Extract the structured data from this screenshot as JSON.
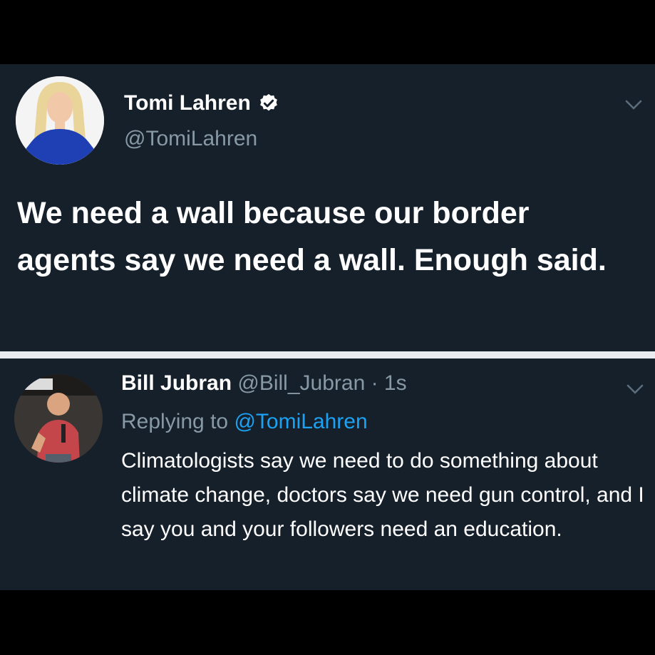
{
  "tweet": {
    "display_name": "Tomi Lahren",
    "handle": "@TomiLahren",
    "verified_icon": "verified-badge-icon",
    "text": "We need a wall because our border agents say we need a wall. Enough said.",
    "menu_icon": "chevron-down-icon"
  },
  "reply": {
    "display_name": "Bill Jubran",
    "handle": "@Bill_Jubran",
    "separator": " · ",
    "time": "1s",
    "replying_to_label": "Replying to",
    "replying_to_handle": "@TomiLahren",
    "text": "Climatologists say we need to do something about climate change, doctors say we need gun control, and I say you and your followers need an education.",
    "menu_icon": "chevron-down-icon"
  },
  "colors": {
    "background": "#15202b",
    "frame": "#000000",
    "divider": "#e9ecef",
    "secondary_text": "#8899a6",
    "link": "#1da1f2"
  }
}
